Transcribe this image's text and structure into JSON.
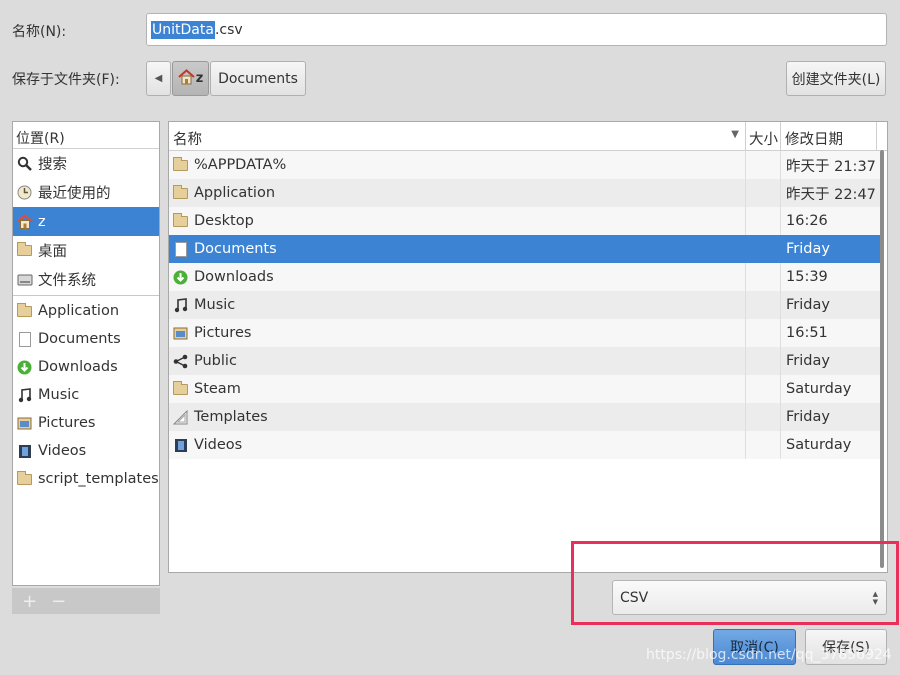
{
  "dialog": {
    "name_label": "名称(N):",
    "filename_selected": "UnitData",
    "filename_ext": ".csv",
    "save_in_label": "保存于文件夹(F):",
    "path_back": "◀",
    "path_home": "z",
    "path_current": "Documents",
    "create_folder_label": "创建文件夹(L)"
  },
  "places": {
    "header": "位置(R)",
    "system": [
      {
        "label": "搜索",
        "icon": "search-icon"
      },
      {
        "label": "最近使用的",
        "icon": "recent-icon"
      },
      {
        "label": "z",
        "icon": "home-icon"
      },
      {
        "label": "桌面",
        "icon": "folder-icon"
      },
      {
        "label": "文件系统",
        "icon": "drive-icon"
      }
    ],
    "bookmarks": [
      {
        "label": "Application",
        "icon": "folder-icon"
      },
      {
        "label": "Documents",
        "icon": "document-icon"
      },
      {
        "label": "Downloads",
        "icon": "download-icon"
      },
      {
        "label": "Music",
        "icon": "music-icon"
      },
      {
        "label": "Pictures",
        "icon": "pictures-icon"
      },
      {
        "label": "Videos",
        "icon": "videos-icon"
      },
      {
        "label": "script_templates",
        "icon": "folder-icon"
      }
    ],
    "add": "+",
    "remove": "−"
  },
  "files": {
    "columns": {
      "name": "名称",
      "size": "大小",
      "modified": "修改日期"
    },
    "rows": [
      {
        "name": "%APPDATA%",
        "modified": "昨天于 21:37",
        "icon": "folder-icon"
      },
      {
        "name": "Application",
        "modified": "昨天于 22:47",
        "icon": "folder-icon"
      },
      {
        "name": "Desktop",
        "modified": "16:26",
        "icon": "folder-icon"
      },
      {
        "name": "Documents",
        "modified": "Friday",
        "icon": "document-icon"
      },
      {
        "name": "Downloads",
        "modified": "15:39",
        "icon": "download-icon"
      },
      {
        "name": "Music",
        "modified": "Friday",
        "icon": "music-icon"
      },
      {
        "name": "Pictures",
        "modified": "16:51",
        "icon": "pictures-icon"
      },
      {
        "name": "Public",
        "modified": "Friday",
        "icon": "share-icon"
      },
      {
        "name": "Steam",
        "modified": "Saturday",
        "icon": "folder-icon"
      },
      {
        "name": "Templates",
        "modified": "Friday",
        "icon": "templates-icon"
      },
      {
        "name": "Videos",
        "modified": "Saturday",
        "icon": "videos-icon"
      }
    ]
  },
  "filter": {
    "value": "CSV"
  },
  "buttons": {
    "cancel": "取消(C)",
    "save": "保存(S)"
  },
  "watermark": "https://blog.csdn.net/qq_37856924",
  "colors": {
    "selection": "#3d83d3",
    "highlight_box": "#e8305a"
  }
}
